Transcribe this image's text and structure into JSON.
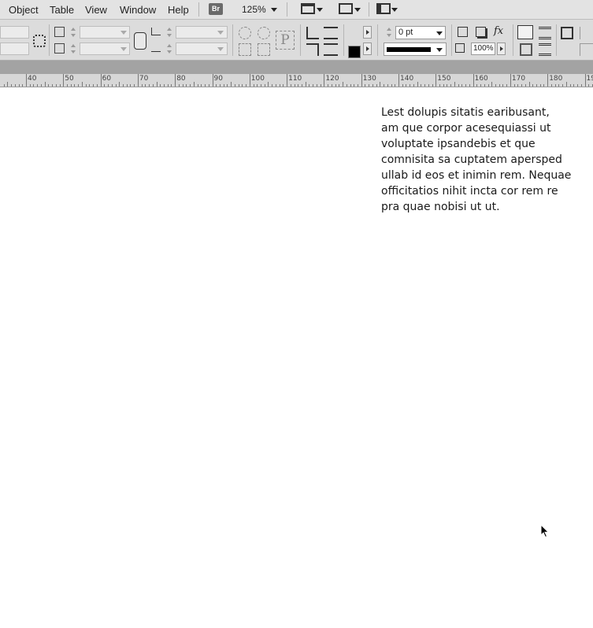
{
  "menu": {
    "items": [
      "Object",
      "Table",
      "View",
      "Window",
      "Help"
    ],
    "bridge_badge": "Br",
    "zoom_level": "125%"
  },
  "control_panel": {
    "stroke_weight": "0 pt",
    "opacity": "100%",
    "fill_color": "#000000",
    "stroke_color": "none",
    "icons": [
      "anchor-icon",
      "link-proportions-icon",
      "rotate-cw-icon",
      "rotate-ccw-icon",
      "paragraph-icon",
      "flip-horizontal-icon",
      "flip-vertical-icon",
      "select-container-icon",
      "select-content-icon",
      "drop-shadow-icon",
      "effects-fx-icon",
      "text-wrap-icon",
      "frame-fitting-icon"
    ]
  },
  "ruler": {
    "labels": [
      "40",
      "50",
      "60",
      "70",
      "80",
      "90",
      "100",
      "110",
      "120",
      "130",
      "140",
      "150",
      "160",
      "170",
      "180",
      "19"
    ]
  },
  "document": {
    "text_lines": [
      "Lest dolupis sitatis earibusant,",
      "am que corpor acesequiassi ut",
      "voluptate ipsandebis et que",
      "comnisita sa cuptatem apersped",
      "ullab id eos et inimin rem. Nequae",
      "officitatios nihit incta cor rem re",
      "pra quae nobisi ut ut."
    ]
  }
}
